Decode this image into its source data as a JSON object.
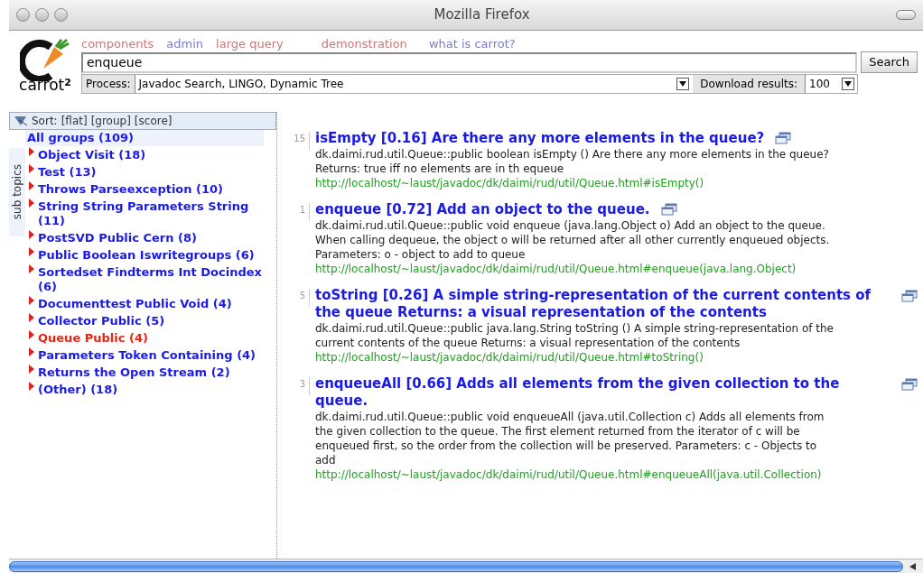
{
  "window": {
    "title": "Mozilla Firefox"
  },
  "logo": {
    "text": "carrot",
    "superscript": "2"
  },
  "nav_links": [
    {
      "label": "components",
      "color": "#c87878"
    },
    {
      "label": "admin",
      "color": "#7b7bc8"
    },
    {
      "label": "large query",
      "color": "#c87878"
    },
    {
      "label": "demonstration",
      "color": "#c87878"
    },
    {
      "label": "what is carrot?",
      "color": "#7b7bc8"
    }
  ],
  "search": {
    "value": "enqueue",
    "button": "Search"
  },
  "process": {
    "label": "Process:",
    "value": "Javadoc Search, LINGO, Dynamic Tree"
  },
  "download": {
    "label": "Download results:",
    "value": "100"
  },
  "sort": {
    "label": "Sort:",
    "options": [
      "[flat]",
      "[group]",
      "[score]"
    ]
  },
  "side_tab": "sub topics",
  "all_groups": "All groups (109)",
  "topics": [
    {
      "label": "Object Visit (18)",
      "selected": false
    },
    {
      "label": "Test (13)",
      "selected": false
    },
    {
      "label": "Throws Parseexception (10)",
      "selected": false
    },
    {
      "label": "String String Parameters String (11)",
      "selected": false
    },
    {
      "label": "PostSVD Public Cern (8)",
      "selected": false
    },
    {
      "label": "Public Boolean Iswritegroups (6)",
      "selected": false
    },
    {
      "label": "Sortedset Findterms Int Docindex (6)",
      "selected": false
    },
    {
      "label": "Documenttest Public Void (4)",
      "selected": false
    },
    {
      "label": "Collector Public (5)",
      "selected": false
    },
    {
      "label": "Queue Public (4)",
      "selected": true
    },
    {
      "label": "Parameters Token Containing (4)",
      "selected": false
    },
    {
      "label": "Returns the Open Stream (2)",
      "selected": false
    },
    {
      "label": "(Other) (18)",
      "selected": false
    }
  ],
  "results": [
    {
      "rank": "15",
      "title": "isEmpty [0.16] Are there any more elements in the queue?",
      "snippet": "dk.daimi.rud.util.Queue::public boolean isEmpty () Are there any more elements in the queue? Returns: true iff no elements are in th equeue",
      "url": "http://localhost/~laust/javadoc/dk/daimi/rud/util/Queue.html#isEmpty()"
    },
    {
      "rank": "1",
      "title": "enqueue [0.72] Add an object to the queue.",
      "snippet": "dk.daimi.rud.util.Queue::public void enqueue (java.lang.Object o) Add an object to the queue. When calling dequeue, the object o will be returned after all other currently enqueued objects. Parameters: o - object to add to queue",
      "url": "http://localhost/~laust/javadoc/dk/daimi/rud/util/Queue.html#enqueue(java.lang.Object)"
    },
    {
      "rank": "5",
      "title": "toString [0.26] A simple string-representation of the current contents of the queue Returns: a visual representation of the contents",
      "snippet": "dk.daimi.rud.util.Queue::public java.lang.String toString () A simple string-representation of the current contents of the queue Returns: a visual representation of the contents",
      "url": "http://localhost/~laust/javadoc/dk/daimi/rud/util/Queue.html#toString()"
    },
    {
      "rank": "3",
      "title": "enqueueAll [0.66] Adds all elements from the given collection to the queue.",
      "snippet": "dk.daimi.rud.util.Queue::public void enqueueAll (java.util.Collection c) Adds all elements from the given collection to the queue. The first element returned from the iterator of c will be enqueued first, so the order from the collection will be preserved. Parameters: c - Objects to add",
      "url": "http://localhost/~laust/javadoc/dk/daimi/rud/util/Queue.html#enqueueAll(java.util.Collection)"
    }
  ]
}
